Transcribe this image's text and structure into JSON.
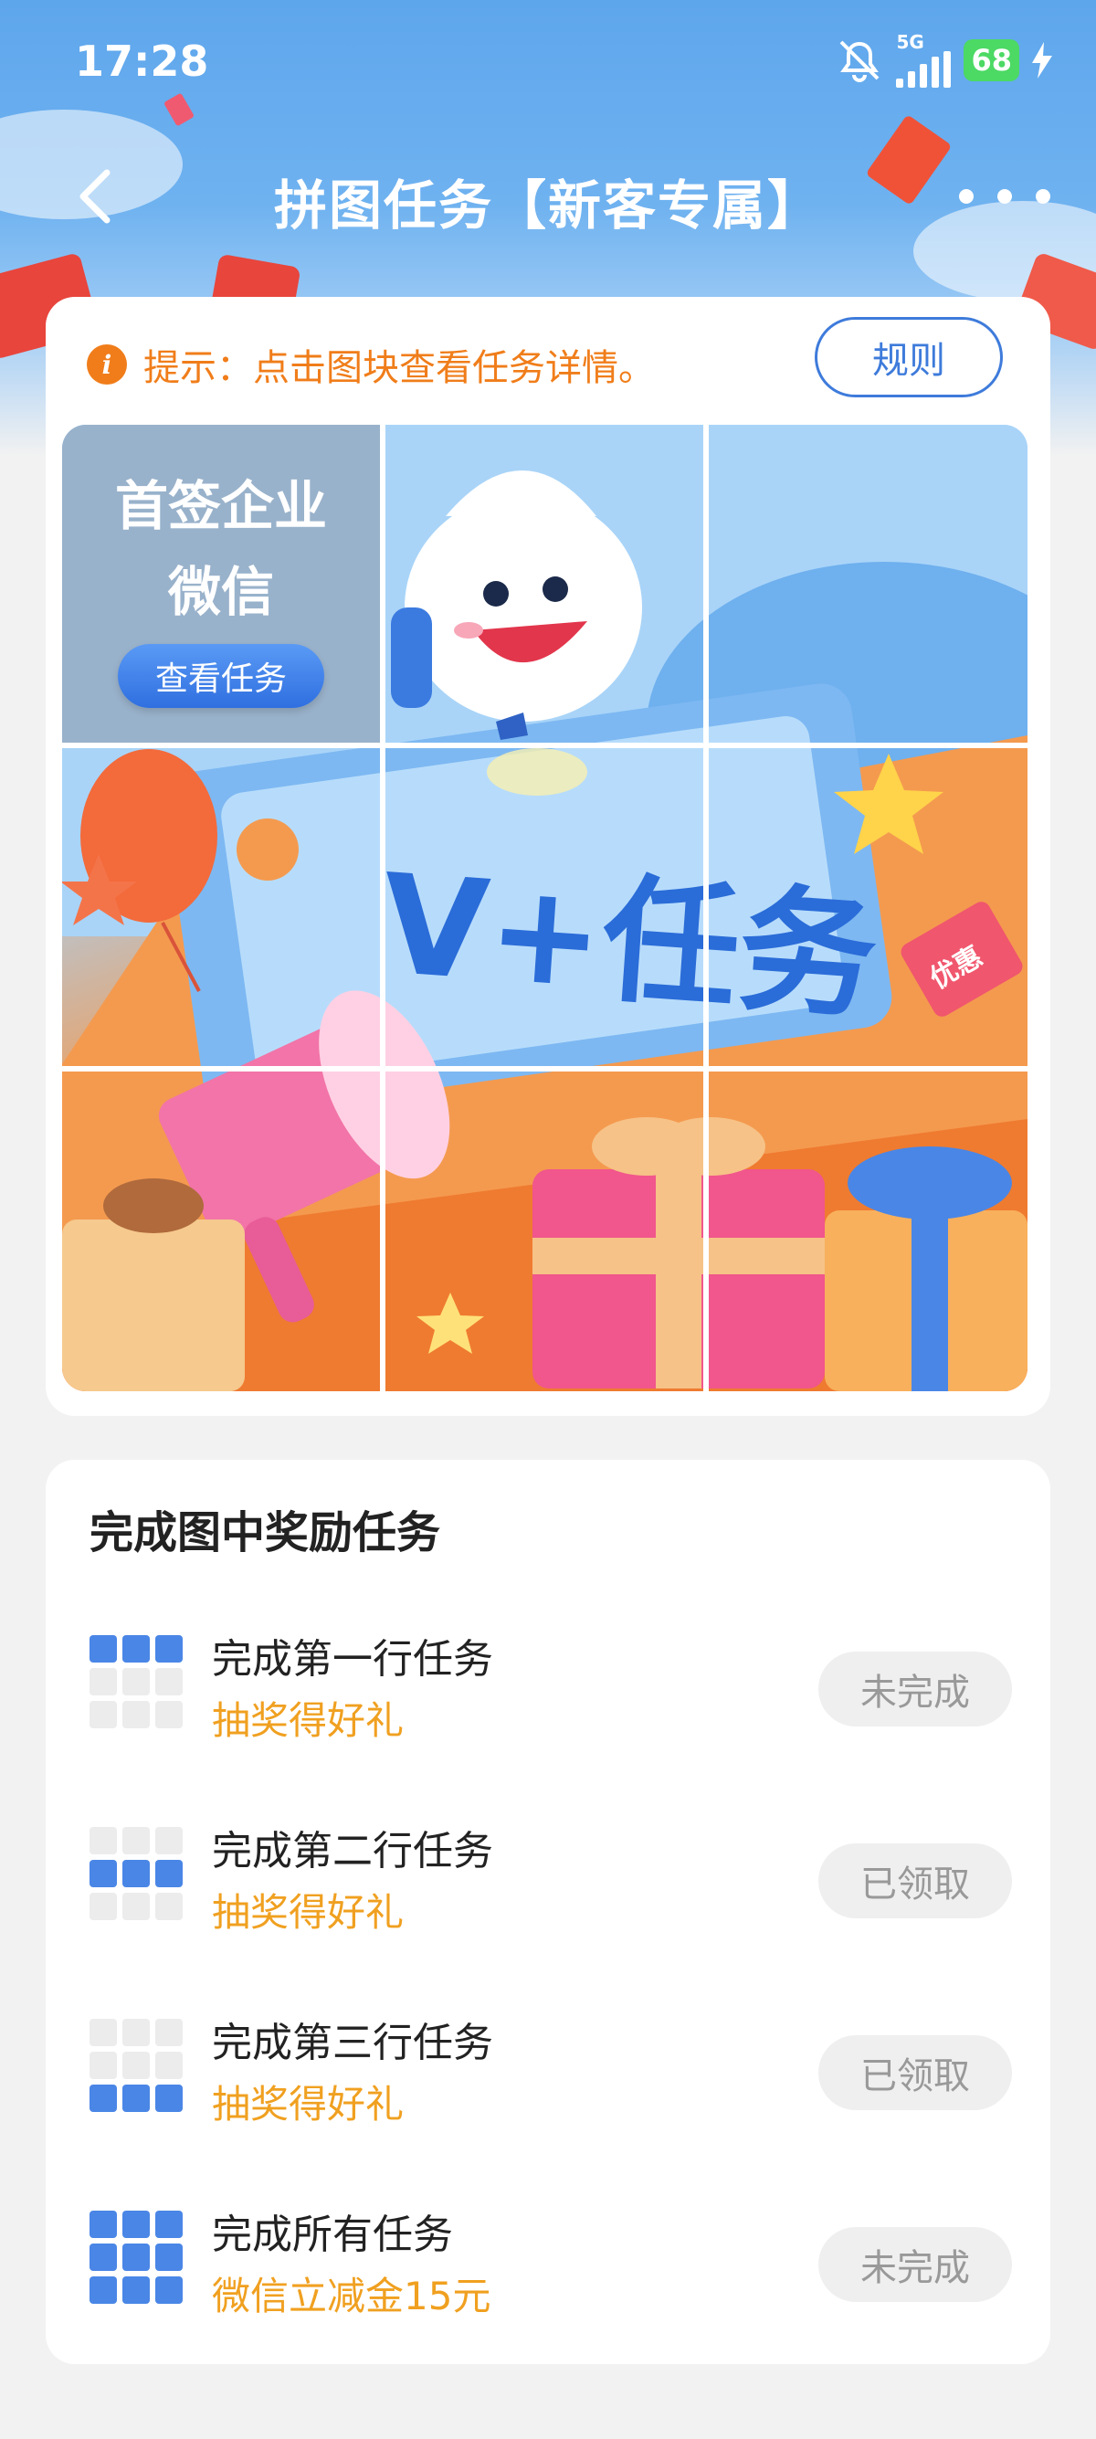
{
  "status_bar": {
    "time": "17:28",
    "network": "5G",
    "battery": "68"
  },
  "navbar": {
    "title": "拼图任务【新客专属】"
  },
  "tip": {
    "text": "提示：点击图块查看任务详情。",
    "rule_label": "规则"
  },
  "puzzle": {
    "locked_tile": {
      "title": "首签企业微信",
      "button": "查看任务"
    },
    "art_text": "V+任务",
    "badge_text": "优惠"
  },
  "rewards": {
    "title": "完成图中奖励任务",
    "items": [
      {
        "title": "完成第一行任务",
        "sub": "抽奖得好礼",
        "status": "未完成",
        "highlight_row": 1
      },
      {
        "title": "完成第二行任务",
        "sub": "抽奖得好礼",
        "status": "已领取",
        "highlight_row": 2
      },
      {
        "title": "完成第三行任务",
        "sub": "抽奖得好礼",
        "status": "已领取",
        "highlight_row": 3
      },
      {
        "title": "完成所有任务",
        "sub": "微信立减金15元",
        "status": "未完成",
        "highlight_row": "all"
      }
    ]
  },
  "colors": {
    "accent_blue": "#3e7bdb",
    "tip_orange": "#f07d1a",
    "reward_gold": "#f0a020"
  }
}
